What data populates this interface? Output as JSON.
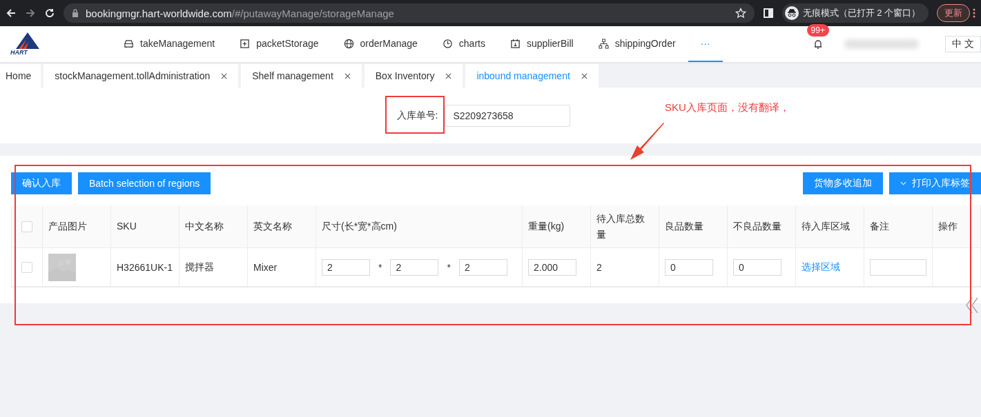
{
  "browser": {
    "url_host": "bookingmgr.hart-worldwide.com",
    "url_path": "/#/putawayManage/storageManage",
    "incognito_label": "无痕模式（已打开 2 个窗口）",
    "update_button": "更新"
  },
  "header": {
    "logo_text": "HART",
    "nav": [
      {
        "kind": "car",
        "label": "takeManagement",
        "selected": false
      },
      {
        "kind": "box",
        "label": "packetStorage",
        "selected": false
      },
      {
        "kind": "globe",
        "label": "orderManage",
        "selected": false
      },
      {
        "kind": "clock",
        "label": "charts",
        "selected": false
      },
      {
        "kind": "bill",
        "label": "supplierBill",
        "selected": false
      },
      {
        "kind": "tree",
        "label": "shippingOrder",
        "selected": false
      },
      {
        "kind": "more",
        "label": "···",
        "selected": true
      }
    ],
    "notification_count": "99+",
    "language": "中 文"
  },
  "tabs": [
    {
      "label": "Home",
      "selected": false,
      "closable": false
    },
    {
      "label": "stockManagement.tollAdministration",
      "selected": false,
      "closable": true
    },
    {
      "label": "Shelf management",
      "selected": false,
      "closable": true
    },
    {
      "label": "Box Inventory",
      "selected": false,
      "closable": true
    },
    {
      "label": "inbound management",
      "selected": true,
      "closable": true
    }
  ],
  "form": {
    "label": "入库单号:",
    "value": "S2209273658"
  },
  "toolbar": {
    "left": [
      {
        "label": "确认入库"
      },
      {
        "label": "Batch selection of regions"
      }
    ],
    "right": [
      {
        "label": "货物多收追加",
        "kind": "plain"
      },
      {
        "label": "打印入库标签",
        "kind": "dropdown"
      }
    ]
  },
  "table": {
    "header_checked": false,
    "columns": [
      "产品图片",
      "SKU",
      "中文名称",
      "英文名称",
      "尺寸(长*宽*高cm)",
      "重量(kg)",
      "待入库总数量",
      "良品数量",
      "不良品数量",
      "待入库区域",
      "备注",
      "操作"
    ],
    "rows": [
      {
        "checked": false,
        "sku": "H32661UK-1",
        "name_cn": "搅拌器",
        "name_en": "Mixer",
        "dims": [
          "2",
          "2",
          "2"
        ],
        "dim_separator": "*",
        "weight": "2.000",
        "total": "2",
        "good": "0",
        "bad": "0",
        "region_link": "选择区域"
      }
    ]
  },
  "annotation": {
    "text": "SKU入库页面，没有翻译，"
  }
}
